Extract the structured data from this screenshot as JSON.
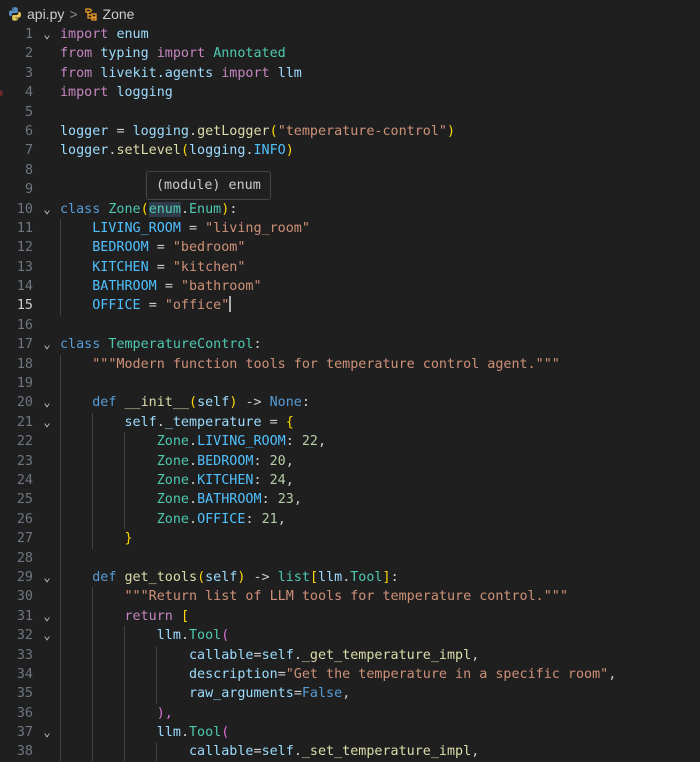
{
  "breadcrumb": {
    "file": "api.py",
    "symbol": "Zone",
    "separator": ">"
  },
  "hover": {
    "text": "(module) enum"
  },
  "gutter": {
    "fold_glyph": "⌄"
  },
  "code": {
    "l1": [
      "import",
      "enum"
    ],
    "l2": [
      "from",
      "typing",
      "import",
      "Annotated"
    ],
    "l3": [
      "from",
      "livekit.agents",
      "import",
      "llm"
    ],
    "l4": [
      "import",
      "logging"
    ],
    "l6": [
      "logger",
      "=",
      "logging",
      ".",
      "getLogger",
      "(",
      "\"temperature-control\"",
      ")"
    ],
    "l7": [
      "logger",
      ".",
      "setLevel",
      "(",
      "logging",
      ".",
      "INFO",
      ")"
    ],
    "l10": [
      "class",
      "Zone",
      "(",
      "enum",
      ".",
      "Enum",
      ")",
      ":"
    ],
    "l11": [
      "LIVING_ROOM",
      "=",
      "\"living_room\""
    ],
    "l12": [
      "BEDROOM",
      "=",
      "\"bedroom\""
    ],
    "l13": [
      "KITCHEN",
      "=",
      "\"kitchen\""
    ],
    "l14": [
      "BATHROOM",
      "=",
      "\"bathroom\""
    ],
    "l15": [
      "OFFICE",
      "=",
      "\"office\""
    ],
    "l17": [
      "class",
      "TemperatureControl",
      ":"
    ],
    "l18": [
      "\"\"\"Modern function tools for temperature control agent.\"\"\""
    ],
    "l20": [
      "def",
      "__init__",
      "(",
      "self",
      ")",
      "->",
      "None",
      ":"
    ],
    "l21": [
      "self",
      ".",
      "_temperature",
      "=",
      "{"
    ],
    "l22": [
      "Zone",
      ".",
      "LIVING_ROOM",
      ":",
      "22",
      ","
    ],
    "l23": [
      "Zone",
      ".",
      "BEDROOM",
      ":",
      "20",
      ","
    ],
    "l24": [
      "Zone",
      ".",
      "KITCHEN",
      ":",
      "24",
      ","
    ],
    "l25": [
      "Zone",
      ".",
      "BATHROOM",
      ":",
      "23",
      ","
    ],
    "l26": [
      "Zone",
      ".",
      "OFFICE",
      ":",
      "21",
      ","
    ],
    "l27": [
      "}"
    ],
    "l29": [
      "def",
      "get_tools",
      "(",
      "self",
      ")",
      "->",
      "list",
      "[",
      "llm",
      ".",
      "Tool",
      "]",
      ":"
    ],
    "l30": [
      "\"\"\"Return list of LLM tools for temperature control.\"\"\""
    ],
    "l31": [
      "return",
      "["
    ],
    "l32": [
      "llm",
      ".",
      "Tool",
      "("
    ],
    "l33": [
      "callable",
      "=",
      "self",
      ".",
      "_get_temperature_impl",
      ","
    ],
    "l34": [
      "description",
      "=",
      "\"Get the temperature in a specific room\"",
      ","
    ],
    "l35": [
      "raw_arguments",
      "=",
      "False",
      ","
    ],
    "l36": [
      "),"
    ],
    "l37": [
      "llm",
      ".",
      "Tool",
      "("
    ],
    "l38": [
      "callable",
      "=",
      "self",
      ".",
      "_set_temperature_impl",
      ","
    ]
  }
}
